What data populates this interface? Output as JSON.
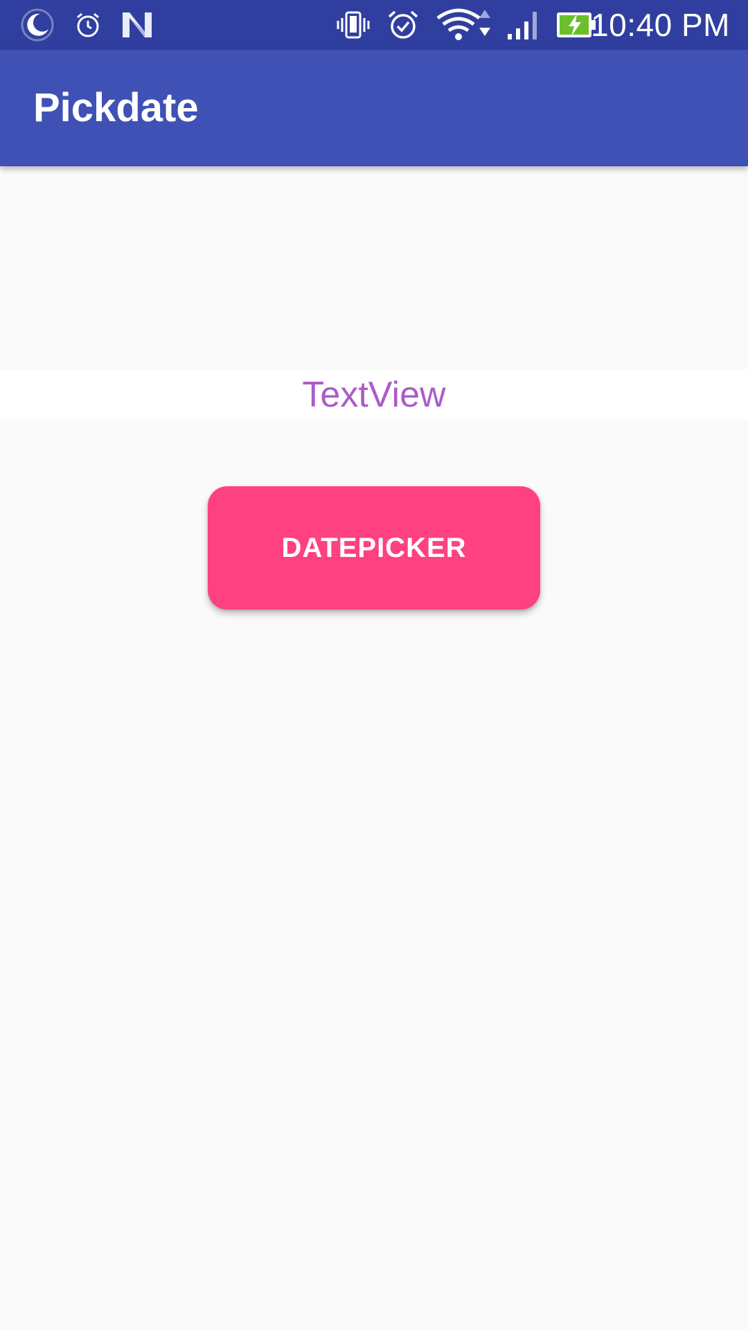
{
  "status_bar": {
    "time": "10:40 PM",
    "left_icons": [
      "moon-icon",
      "alarm-icon",
      "n-logo-icon"
    ],
    "right_icons": [
      "vibrate-icon",
      "alarm-check-icon",
      "wifi-icon",
      "signal-icon",
      "battery-charging-icon"
    ],
    "background": "#303f9f"
  },
  "app_bar": {
    "title": "Pickdate",
    "background": "#3f51b5"
  },
  "main": {
    "textview_label": "TextView",
    "textview_color": "#ab5cc7",
    "datepicker_label": "DATEPICKER",
    "datepicker_color": "#ff4081"
  }
}
